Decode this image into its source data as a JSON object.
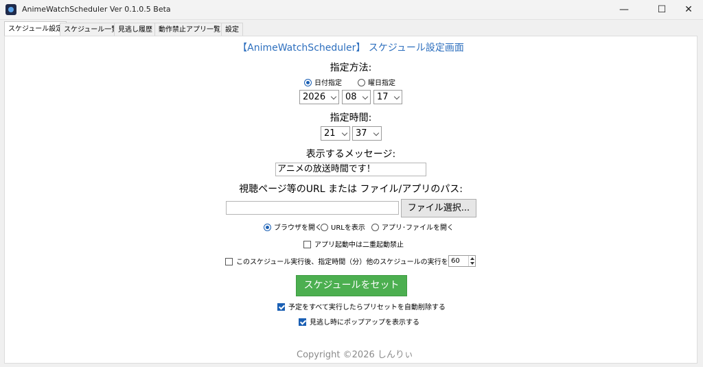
{
  "window": {
    "title": "AnimeWatchScheduler Ver 0.1.0.5 Beta",
    "minimize": "—",
    "maximize": "☐",
    "close": "✕"
  },
  "tabs": [
    "スケジュール設定",
    "スケジュール一覧",
    "見逃し履歴",
    "動作禁止アプリ一覧",
    "設定"
  ],
  "header": "【AnimeWatchScheduler】 スケジュール設定画面",
  "method": {
    "label": "指定方法:",
    "options": [
      "日付指定",
      "曜日指定"
    ],
    "selected": 0
  },
  "date": {
    "year": "2026",
    "month": "08",
    "day": "17"
  },
  "time": {
    "label": "指定時間:",
    "hour": "21",
    "minute": "37"
  },
  "message": {
    "label": "表示するメッセージ:",
    "value": "アニメの放送時間です！"
  },
  "target": {
    "label": "視聴ページ等のURL または ファイル/アプリのパス:",
    "value": "",
    "file_button": "ファイル選択..."
  },
  "action": {
    "options": [
      "ブラウザを開く",
      "URLを表示",
      "アプリ･ファイルを開く"
    ],
    "selected": 0
  },
  "no_double_launch": {
    "label": "アプリ起動中は二重起動禁止",
    "checked": false
  },
  "stop_others": {
    "label": "このスケジュール実行後、指定時間（分）他のスケジュールの実行を停止：",
    "checked": false,
    "minutes": "60"
  },
  "set_button": "スケジュールをセット",
  "auto_delete": {
    "label": "予定をすべて実行したらプリセットを自動削除する",
    "checked": true
  },
  "popup_on_miss": {
    "label": "見逃し時にポップアップを表示する",
    "checked": true
  },
  "copyright": "Copyright ©2026 しんりぃ",
  "colors": {
    "accent": "#2d6fbe",
    "set_button": "#4caf50",
    "radio_check": "#1a5fb4"
  }
}
